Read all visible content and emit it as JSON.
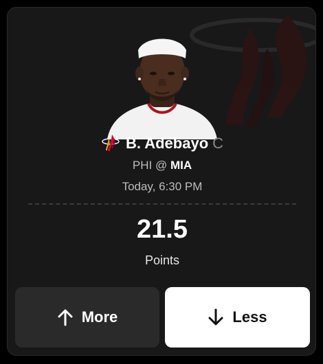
{
  "player": {
    "name": "B. Adebayo",
    "position": "C",
    "team_logo_icon": "miami-heat-logo-icon"
  },
  "matchup": {
    "away": "PHI",
    "separator": "@",
    "home": "MIA"
  },
  "game_time": "Today, 6:30 PM",
  "projection": {
    "value": "21.5",
    "stat": "Points"
  },
  "buttons": {
    "more_label": "More",
    "less_label": "Less",
    "more_icon": "arrow-up-icon",
    "less_icon": "arrow-down-icon"
  },
  "colors": {
    "card_background": "#181818",
    "more_button": "#2a2a2a",
    "less_button": "#ffffff",
    "team_red": "#c8102e"
  }
}
